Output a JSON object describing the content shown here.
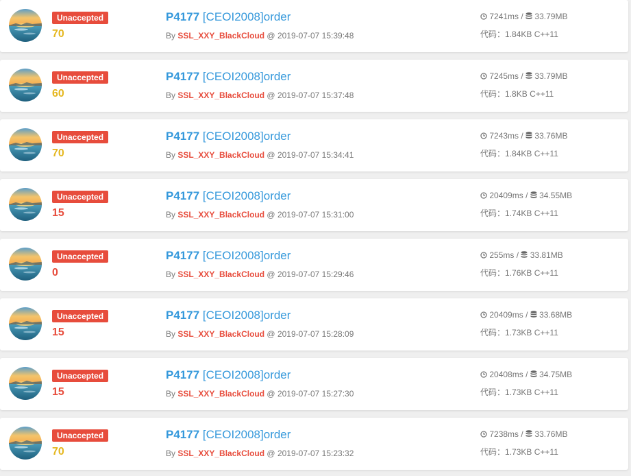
{
  "colors": {
    "badge_bg": "#e74c3c",
    "score_yellow": "#e5b71f",
    "score_red": "#e74c3c",
    "link_blue": "#3498db",
    "user_red": "#e74c3c",
    "meta_gray": "#777777",
    "background": "#efefef"
  },
  "icons": {
    "time": "clock-icon",
    "memory": "database-icon",
    "avatar": "user-avatar-landscape"
  },
  "labels": {
    "by": "By",
    "at": "@",
    "separator": "/",
    "code_prefix": "代码："
  },
  "records": [
    {
      "status": "Unaccepted",
      "score": "70",
      "score_color": "#e5b71f",
      "pid": "P4177",
      "pname": "[CEOI2008]order",
      "user": "SSL_XXY_BlackCloud",
      "datetime": "2019-07-07 15:39:48",
      "time": "7241ms",
      "memory": "33.79MB",
      "code_size": "1.84KB",
      "language": "C++11"
    },
    {
      "status": "Unaccepted",
      "score": "60",
      "score_color": "#e5b71f",
      "pid": "P4177",
      "pname": "[CEOI2008]order",
      "user": "SSL_XXY_BlackCloud",
      "datetime": "2019-07-07 15:37:48",
      "time": "7245ms",
      "memory": "33.79MB",
      "code_size": "1.8KB",
      "language": "C++11"
    },
    {
      "status": "Unaccepted",
      "score": "70",
      "score_color": "#e5b71f",
      "pid": "P4177",
      "pname": "[CEOI2008]order",
      "user": "SSL_XXY_BlackCloud",
      "datetime": "2019-07-07 15:34:41",
      "time": "7243ms",
      "memory": "33.76MB",
      "code_size": "1.84KB",
      "language": "C++11"
    },
    {
      "status": "Unaccepted",
      "score": "15",
      "score_color": "#e74c3c",
      "pid": "P4177",
      "pname": "[CEOI2008]order",
      "user": "SSL_XXY_BlackCloud",
      "datetime": "2019-07-07 15:31:00",
      "time": "20409ms",
      "memory": "34.55MB",
      "code_size": "1.74KB",
      "language": "C++11"
    },
    {
      "status": "Unaccepted",
      "score": "0",
      "score_color": "#e74c3c",
      "pid": "P4177",
      "pname": "[CEOI2008]order",
      "user": "SSL_XXY_BlackCloud",
      "datetime": "2019-07-07 15:29:46",
      "time": "255ms",
      "memory": "33.81MB",
      "code_size": "1.76KB",
      "language": "C++11"
    },
    {
      "status": "Unaccepted",
      "score": "15",
      "score_color": "#e74c3c",
      "pid": "P4177",
      "pname": "[CEOI2008]order",
      "user": "SSL_XXY_BlackCloud",
      "datetime": "2019-07-07 15:28:09",
      "time": "20409ms",
      "memory": "33.68MB",
      "code_size": "1.73KB",
      "language": "C++11"
    },
    {
      "status": "Unaccepted",
      "score": "15",
      "score_color": "#e74c3c",
      "pid": "P4177",
      "pname": "[CEOI2008]order",
      "user": "SSL_XXY_BlackCloud",
      "datetime": "2019-07-07 15:27:30",
      "time": "20408ms",
      "memory": "34.75MB",
      "code_size": "1.73KB",
      "language": "C++11"
    },
    {
      "status": "Unaccepted",
      "score": "70",
      "score_color": "#e5b71f",
      "pid": "P4177",
      "pname": "[CEOI2008]order",
      "user": "SSL_XXY_BlackCloud",
      "datetime": "2019-07-07 15:23:32",
      "time": "7238ms",
      "memory": "33.76MB",
      "code_size": "1.73KB",
      "language": "C++11"
    }
  ]
}
